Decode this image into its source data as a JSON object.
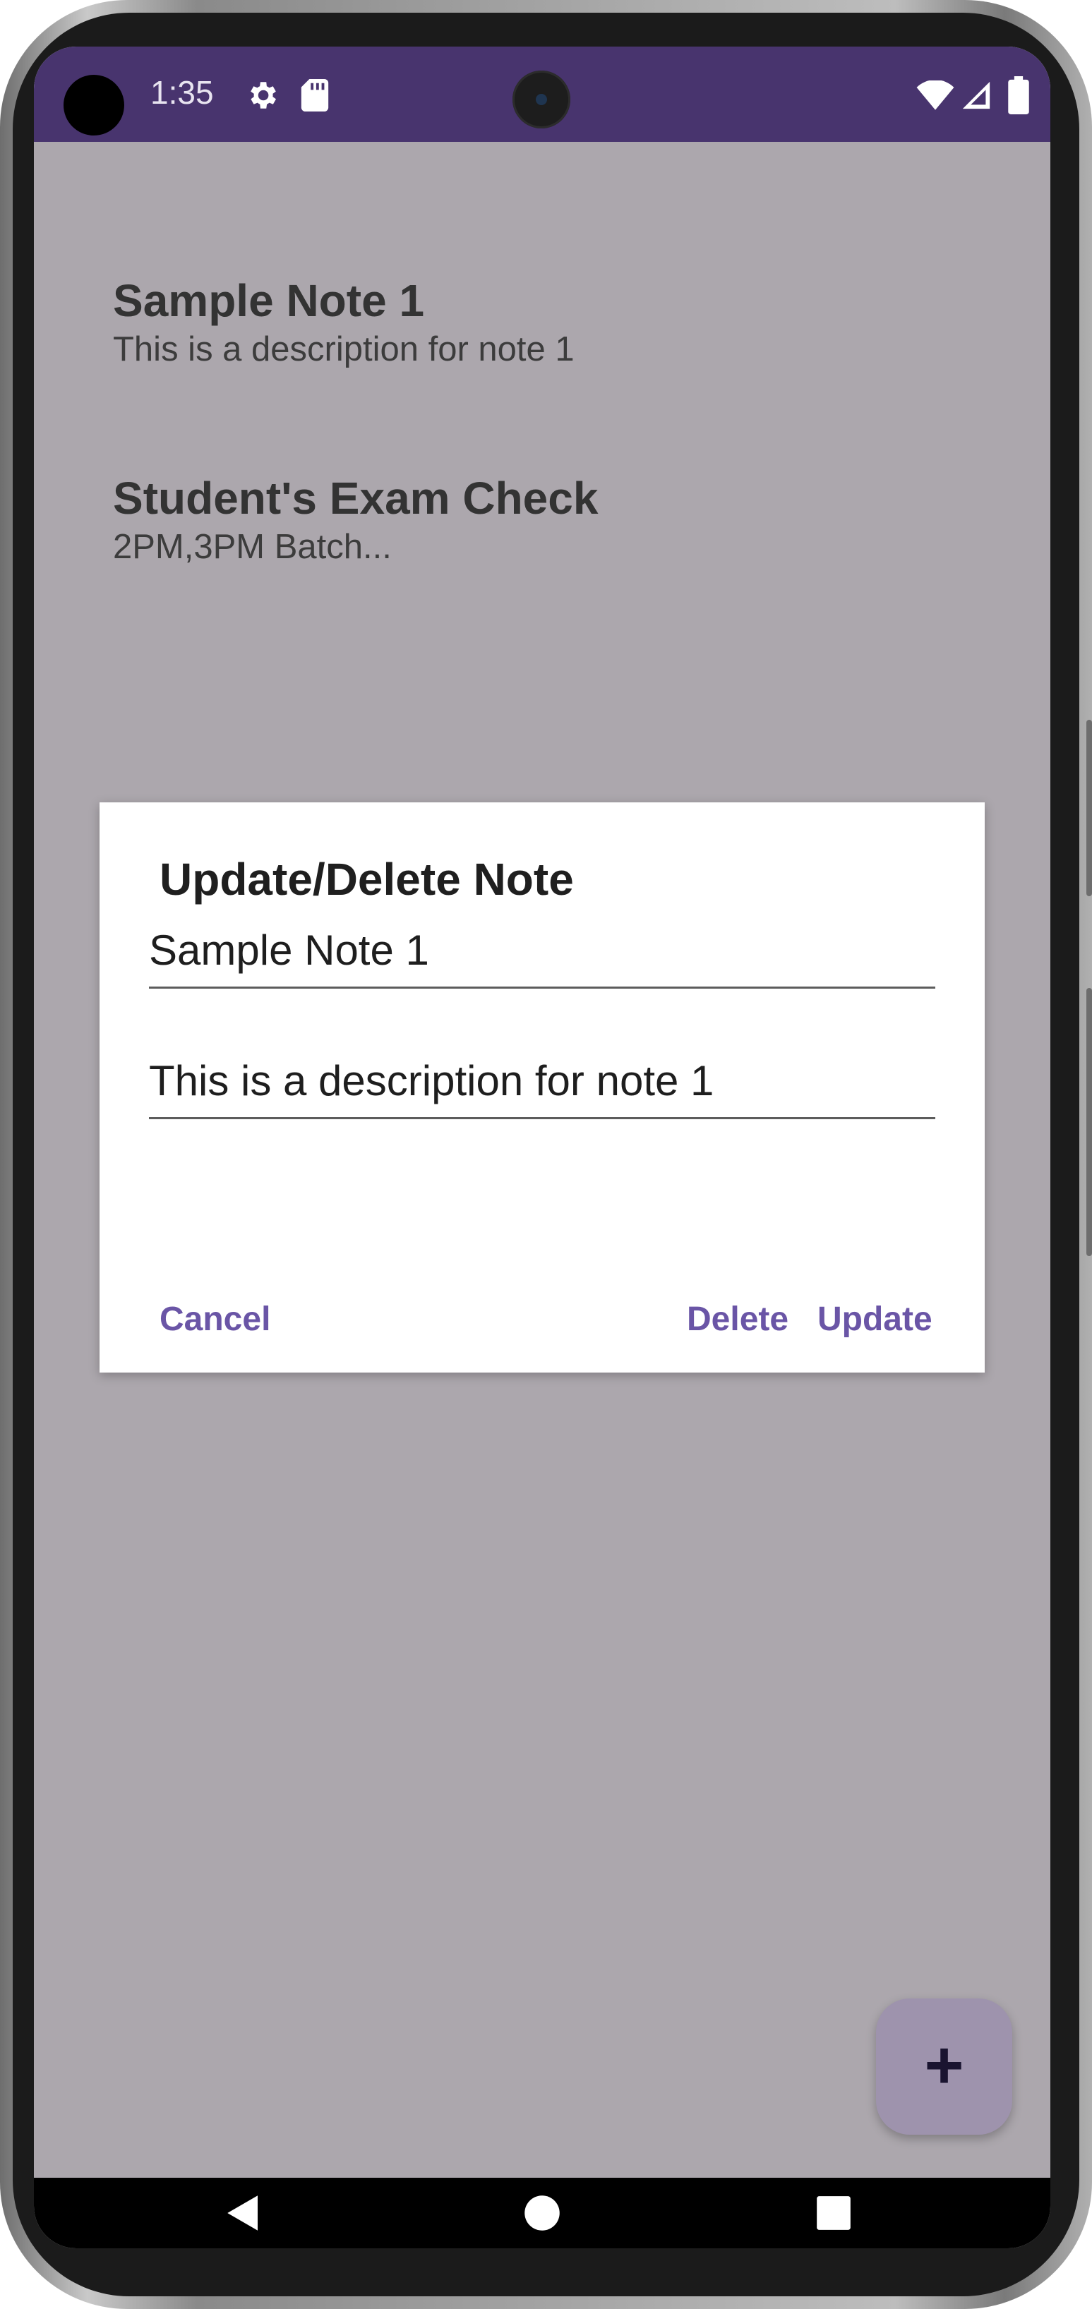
{
  "status_bar": {
    "time": "1:35",
    "icons": [
      "gear-icon",
      "sd-card-icon",
      "wifi-icon",
      "signal-icon",
      "battery-icon"
    ]
  },
  "notes": [
    {
      "title": "Sample Note 1",
      "description": "This is a description for note 1"
    },
    {
      "title": "Student's Exam Check",
      "description": "2PM,3PM Batch..."
    }
  ],
  "dialog": {
    "title": "Update/Delete Note",
    "title_field_value": "Sample Note 1",
    "description_field_value": "This is a description for note 1",
    "cancel_label": "Cancel",
    "delete_label": "Delete",
    "update_label": "Update"
  },
  "fab": {
    "label": "+"
  },
  "nav_bar": {
    "icons": [
      "back-icon",
      "home-icon",
      "recents-icon"
    ]
  },
  "colors": {
    "status_bar": "#48346e",
    "scrim_background": "#aca7ad",
    "accent": "#6a55a6",
    "fab": "#9e93ad"
  }
}
